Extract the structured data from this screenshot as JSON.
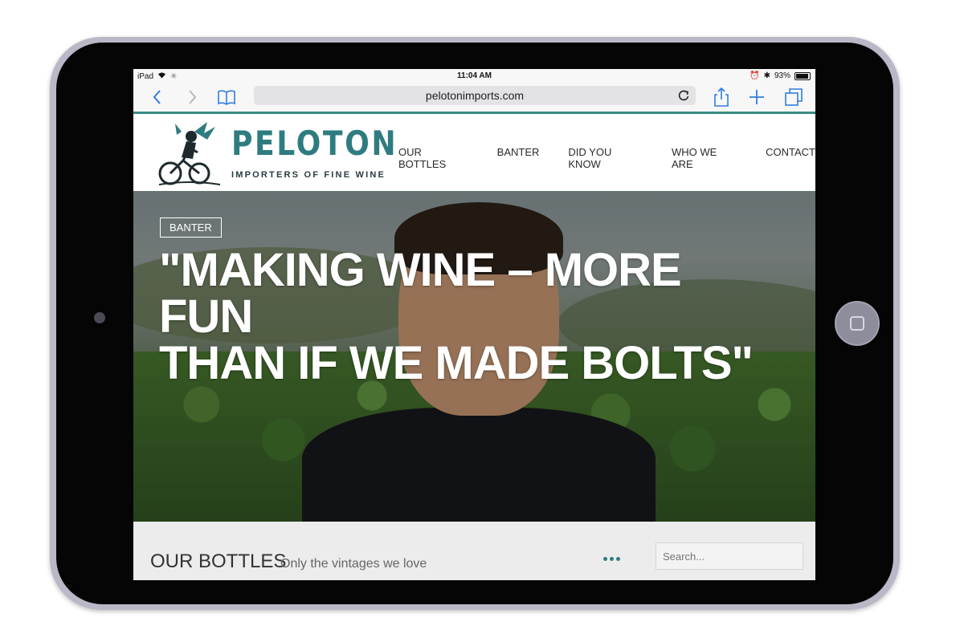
{
  "status_bar": {
    "device": "iPad",
    "time": "11:04 AM",
    "battery": "93%",
    "battery_level": 0.93
  },
  "browser": {
    "url": "pelotonimports.com"
  },
  "site": {
    "logo_word": "PELOTON",
    "logo_tagline": "IMPORTERS OF FINE WINE",
    "nav": [
      "OUR BOTTLES",
      "BANTER",
      "DID YOU KNOW",
      "WHO WE ARE",
      "CONTACT"
    ]
  },
  "hero": {
    "badge": "BANTER",
    "headline_line1": "\"MAKING WINE – MORE FUN",
    "headline_line2": "THAN IF WE MADE BOLTS\""
  },
  "bottles": {
    "title": "OUR BOTTLES",
    "subtitle": "Only the vintages we love",
    "search_placeholder": "Search..."
  },
  "colors": {
    "brand_teal": "#2f7c80",
    "ios_blue": "#2f7de1"
  }
}
